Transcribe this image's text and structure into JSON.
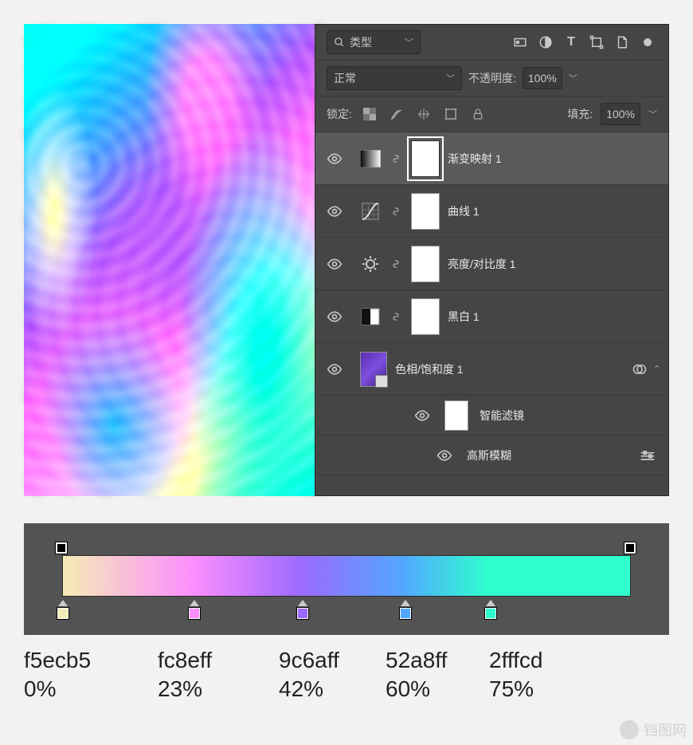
{
  "filter": {
    "label": "类型"
  },
  "blend": {
    "mode": "正常",
    "opacity_label": "不透明度:",
    "opacity_value": "100%"
  },
  "lock": {
    "label": "锁定:",
    "fill_label": "填充:",
    "fill_value": "100%"
  },
  "layers": [
    {
      "name": "渐变映射 1"
    },
    {
      "name": "曲线 1"
    },
    {
      "name": "亮度/对比度 1"
    },
    {
      "name": "黑白 1"
    },
    {
      "name": "色相/饱和度 1"
    }
  ],
  "smart_filters": {
    "heading": "智能滤镜",
    "items": [
      "高斯模糊"
    ]
  },
  "gradient_stops": [
    {
      "hex": "f5ecb5",
      "pos": "0%",
      "pct": 0
    },
    {
      "hex": "fc8eff",
      "pos": "23%",
      "pct": 23
    },
    {
      "hex": "9c6aff",
      "pos": "42%",
      "pct": 42
    },
    {
      "hex": "52a8ff",
      "pos": "60%",
      "pct": 60
    },
    {
      "hex": "2fffcd",
      "pos": "75%",
      "pct": 75
    }
  ],
  "watermark": "铛图网"
}
